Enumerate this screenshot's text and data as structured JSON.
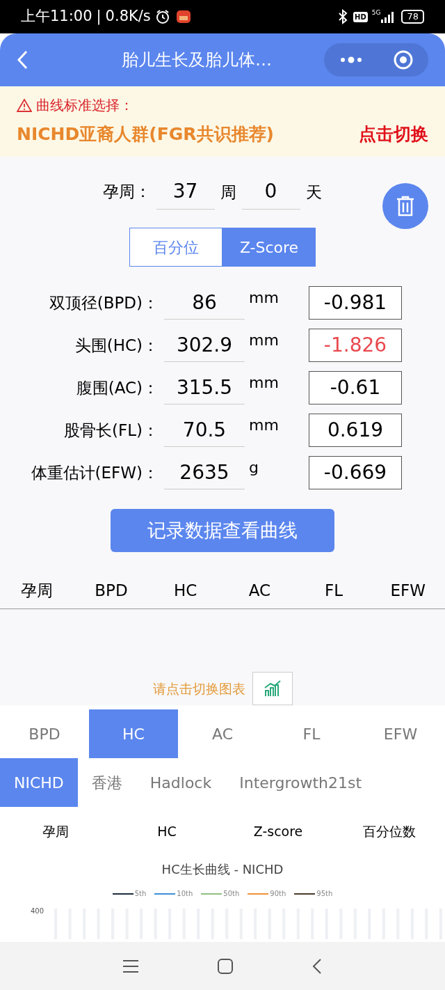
{
  "status_bar": {
    "time": "上午11:00",
    "speed": "0.8K/s",
    "separator": "|",
    "hd": "HD",
    "network": "5G",
    "battery": "78"
  },
  "header": {
    "title": "胎儿生长及胎儿体…"
  },
  "notice": {
    "label": "曲线标准选择：",
    "standard": "NICHD亚裔人群(FGR共识推荐)",
    "switch": "点击切换"
  },
  "gestation": {
    "label": "孕周：",
    "weeks": "37",
    "weeks_unit": "周",
    "days": "0",
    "days_unit": "天"
  },
  "mode_toggle": [
    {
      "label": "百分位",
      "selected": false
    },
    {
      "label": "Z-Score",
      "selected": true
    }
  ],
  "measurements": [
    {
      "label": "双顶径(BPD)：",
      "value": "86",
      "unit": "mm",
      "zscore": "-0.981",
      "flagged": false
    },
    {
      "label": "头围(HC)：",
      "value": "302.9",
      "unit": "mm",
      "zscore": "-1.826",
      "flagged": true
    },
    {
      "label": "腹围(AC)：",
      "value": "315.5",
      "unit": "mm",
      "zscore": "-0.61",
      "flagged": false
    },
    {
      "label": "股骨长(FL)：",
      "value": "70.5",
      "unit": "mm",
      "zscore": "0.619",
      "flagged": false
    },
    {
      "label": "体重估计(EFW)：",
      "value": "2635",
      "unit": "g",
      "zscore": "-0.669",
      "flagged": false
    }
  ],
  "record_button": "记录数据查看曲线",
  "record_table": {
    "columns": [
      "孕周",
      "BPD",
      "HC",
      "AC",
      "FL",
      "EFW"
    ]
  },
  "chart_hint": "请点击切换图表",
  "metric_tabs": [
    {
      "label": "BPD",
      "selected": false
    },
    {
      "label": "HC",
      "selected": true
    },
    {
      "label": "AC",
      "selected": false
    },
    {
      "label": "FL",
      "selected": false
    },
    {
      "label": "EFW",
      "selected": false
    }
  ],
  "standard_tabs": [
    {
      "label": "NICHD",
      "selected": true
    },
    {
      "label": "香港",
      "selected": false
    },
    {
      "label": "Hadlock",
      "selected": false
    },
    {
      "label": "Intergrowth21st",
      "selected": false
    }
  ],
  "result_table": {
    "columns": [
      "孕周",
      "HC",
      "Z-score",
      "百分位数"
    ]
  },
  "chart": {
    "title": "HC生长曲线 - NICHD",
    "legend": [
      {
        "name": "5th",
        "color": "#1f2d3d"
      },
      {
        "name": "10th",
        "color": "#3b8fd9"
      },
      {
        "name": "50th",
        "color": "#8fbf7f"
      },
      {
        "name": "90th",
        "color": "#f0923a"
      },
      {
        "name": "95th",
        "color": "#4a3b2a"
      }
    ],
    "y_tick": "400"
  }
}
